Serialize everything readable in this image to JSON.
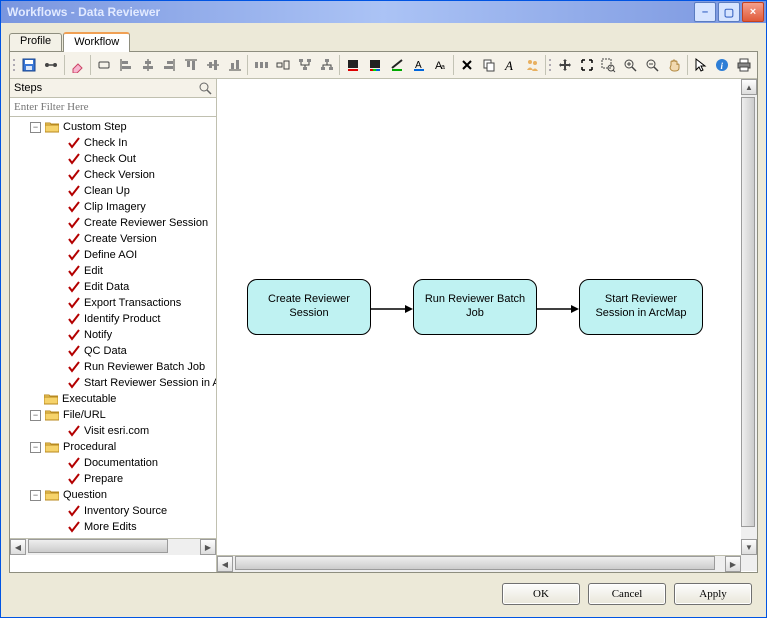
{
  "window": {
    "title": "Workflows - Data Reviewer",
    "buttons": {
      "min": "–",
      "max": "▢",
      "close": "×"
    }
  },
  "tabs": [
    {
      "id": "profile",
      "label": "Profile",
      "active": false
    },
    {
      "id": "workflow",
      "label": "Workflow",
      "active": true
    }
  ],
  "toolbar_icons": [
    "save-icon",
    "link-icon",
    "eraser-icon",
    "node-icon",
    "align-left-icon",
    "align-center-h-icon",
    "align-right-icon",
    "align-top-icon",
    "align-center-v-icon",
    "align-bottom-icon",
    "distribute-h-icon",
    "resize-icon",
    "flow-icon",
    "hierarchy-icon",
    "fill-color-icon",
    "fill-gradient-icon",
    "line-color-icon",
    "font-color-icon",
    "font-icon",
    "delete-icon",
    "copy-icon",
    "text-icon",
    "people-icon",
    "pan-icon",
    "fit-icon",
    "zoom-region-icon",
    "zoom-in-icon",
    "zoom-out-icon",
    "hand-icon",
    "pointer-icon",
    "info-icon",
    "print-icon"
  ],
  "side": {
    "title": "Steps",
    "filter_placeholder": "Enter Filter Here"
  },
  "tree": {
    "custom_step": {
      "label": "Custom Step",
      "items": [
        "Check In",
        "Check Out",
        "Check Version",
        "Clean Up",
        "Clip Imagery",
        "Create Reviewer Session",
        "Create Version",
        "Define AOI",
        "Edit",
        "Edit Data",
        "Export Transactions",
        "Identify Product",
        "Notify",
        "QC Data",
        "Run Reviewer Batch Job",
        "Start Reviewer Session in ArcMap"
      ]
    },
    "executable": {
      "label": "Executable"
    },
    "file_url": {
      "label": "File/URL",
      "items": [
        "Visit esri.com"
      ]
    },
    "procedural": {
      "label": "Procedural",
      "items": [
        "Documentation",
        "Prepare"
      ]
    },
    "question": {
      "label": "Question",
      "items": [
        "Inventory Source",
        "More Edits"
      ]
    }
  },
  "flow": {
    "nodes": [
      {
        "id": "n1",
        "label": "Create Reviewer Session"
      },
      {
        "id": "n2",
        "label": "Run Reviewer Batch Job"
      },
      {
        "id": "n3",
        "label": "Start Reviewer Session in ArcMap"
      }
    ]
  },
  "buttons": {
    "ok": "OK",
    "cancel": "Cancel",
    "apply": "Apply"
  }
}
